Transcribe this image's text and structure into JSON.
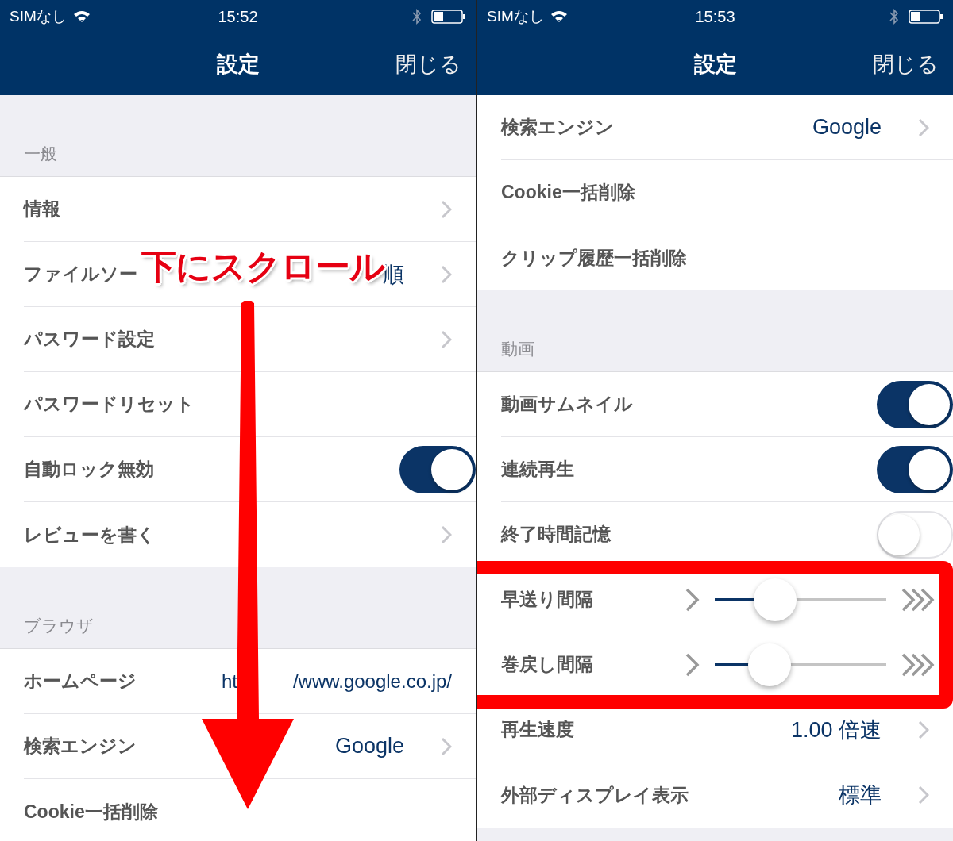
{
  "panels": [
    {
      "status": {
        "carrier": "SIMなし",
        "time": "15:52"
      },
      "title": "設定",
      "close": "閉じる",
      "sections": [
        {
          "header": "一般",
          "rows": [
            {
              "kind": "link",
              "label": "情報"
            },
            {
              "kind": "value",
              "label": "ファイルソー",
              "value": "順"
            },
            {
              "kind": "link",
              "label": "パスワード設定"
            },
            {
              "kind": "action",
              "label": "パスワードリセット"
            },
            {
              "kind": "toggle",
              "label": "自動ロック無効",
              "on": true
            },
            {
              "kind": "link",
              "label": "レビューを書く"
            }
          ]
        },
        {
          "header": "ブラウザ",
          "rows": [
            {
              "kind": "split",
              "label": "ホームページ",
              "value_parts": [
                "ht",
                "/www.google.co.jp/"
              ]
            },
            {
              "kind": "value",
              "label": "検索エンジン",
              "value": "Google"
            },
            {
              "kind": "action",
              "label": "Cookie一括削除"
            }
          ]
        }
      ],
      "annotations": [
        {
          "kind": "caption",
          "text": "下にスクロール"
        },
        {
          "kind": "arrow"
        }
      ]
    },
    {
      "status": {
        "carrier": "SIMなし",
        "time": "15:53"
      },
      "title": "設定",
      "close": "閉じる",
      "sections": [
        {
          "rows": [
            {
              "kind": "value",
              "label": "検索エンジン",
              "value": "Google"
            },
            {
              "kind": "action",
              "label": "Cookie一括削除"
            },
            {
              "kind": "action",
              "label": "クリップ履歴一括削除"
            }
          ]
        },
        {
          "header": "動画",
          "rows": [
            {
              "kind": "toggle",
              "label": "動画サムネイル",
              "on": true
            },
            {
              "kind": "toggle",
              "label": "連続再生",
              "on": true
            },
            {
              "kind": "toggle",
              "label": "終了時間記憶",
              "on": false
            },
            {
              "kind": "slider",
              "label": "早送り間隔",
              "level": 0.35,
              "highlighted": true
            },
            {
              "kind": "slider",
              "label": "巻戻し間隔",
              "level": 0.32,
              "highlighted": true
            },
            {
              "kind": "value",
              "label": "再生速度",
              "value": "1.00 倍速"
            },
            {
              "kind": "value",
              "label": "外部ディスプレイ表示",
              "value": "標準"
            }
          ]
        }
      ]
    }
  ]
}
